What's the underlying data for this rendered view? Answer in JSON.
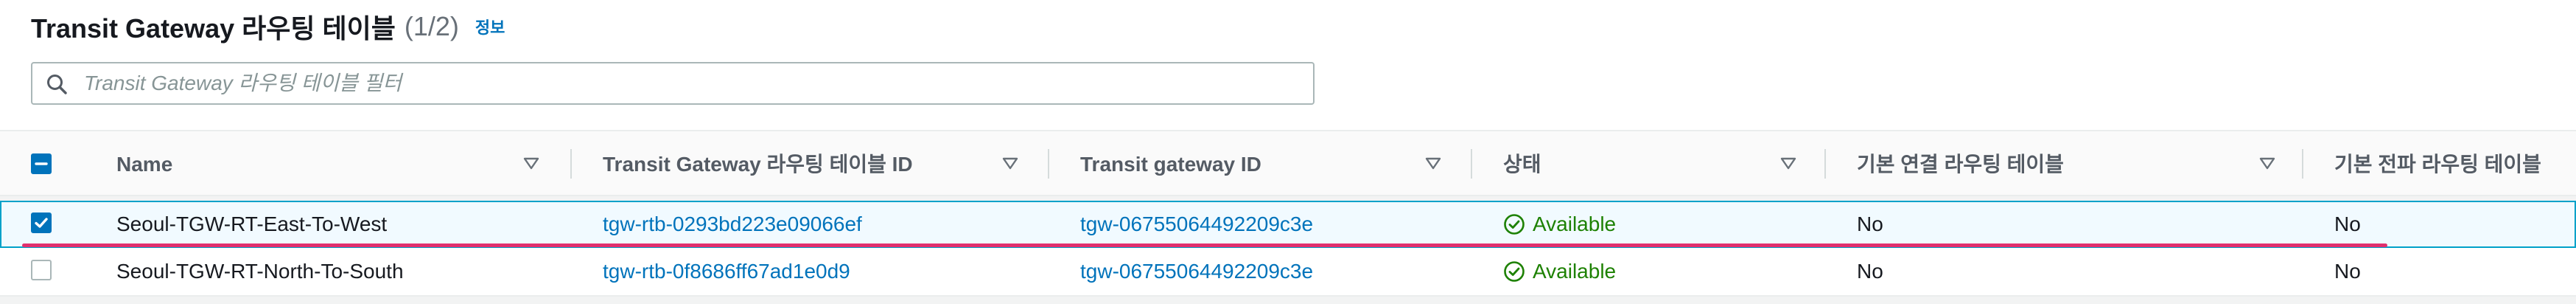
{
  "header": {
    "title": "Transit Gateway 라우팅 테이블",
    "count": "(1/2)",
    "info_link": "정보"
  },
  "search": {
    "placeholder": "Transit Gateway 라우팅 테이블 필터",
    "value": "",
    "icon": "search-icon"
  },
  "table": {
    "select_all_state": "indeterminate",
    "columns": [
      "Name",
      "Transit Gateway 라우팅 테이블 ID",
      "Transit gateway ID",
      "상태",
      "기본 연결 라우팅 테이블",
      "기본 전파 라우팅 테이블"
    ],
    "rows": [
      {
        "selected": true,
        "name": "Seoul-TGW-RT-East-To-West",
        "route_table_id": "tgw-rtb-0293bd223e09066ef",
        "tgw_id": "tgw-06755064492209c3e",
        "status": "Available",
        "default_association": "No",
        "default_propagation": "No"
      },
      {
        "selected": false,
        "name": "Seoul-TGW-RT-North-To-South",
        "route_table_id": "tgw-rtb-0f8686ff67ad1e0d9",
        "tgw_id": "tgw-06755064492209c3e",
        "status": "Available",
        "default_association": "No",
        "default_propagation": "No"
      }
    ]
  },
  "colors": {
    "accent": "#0073bb",
    "status_available": "#1d8102",
    "selected_row_border": "#00a1c9",
    "annotation_underline": "#e0306e"
  }
}
